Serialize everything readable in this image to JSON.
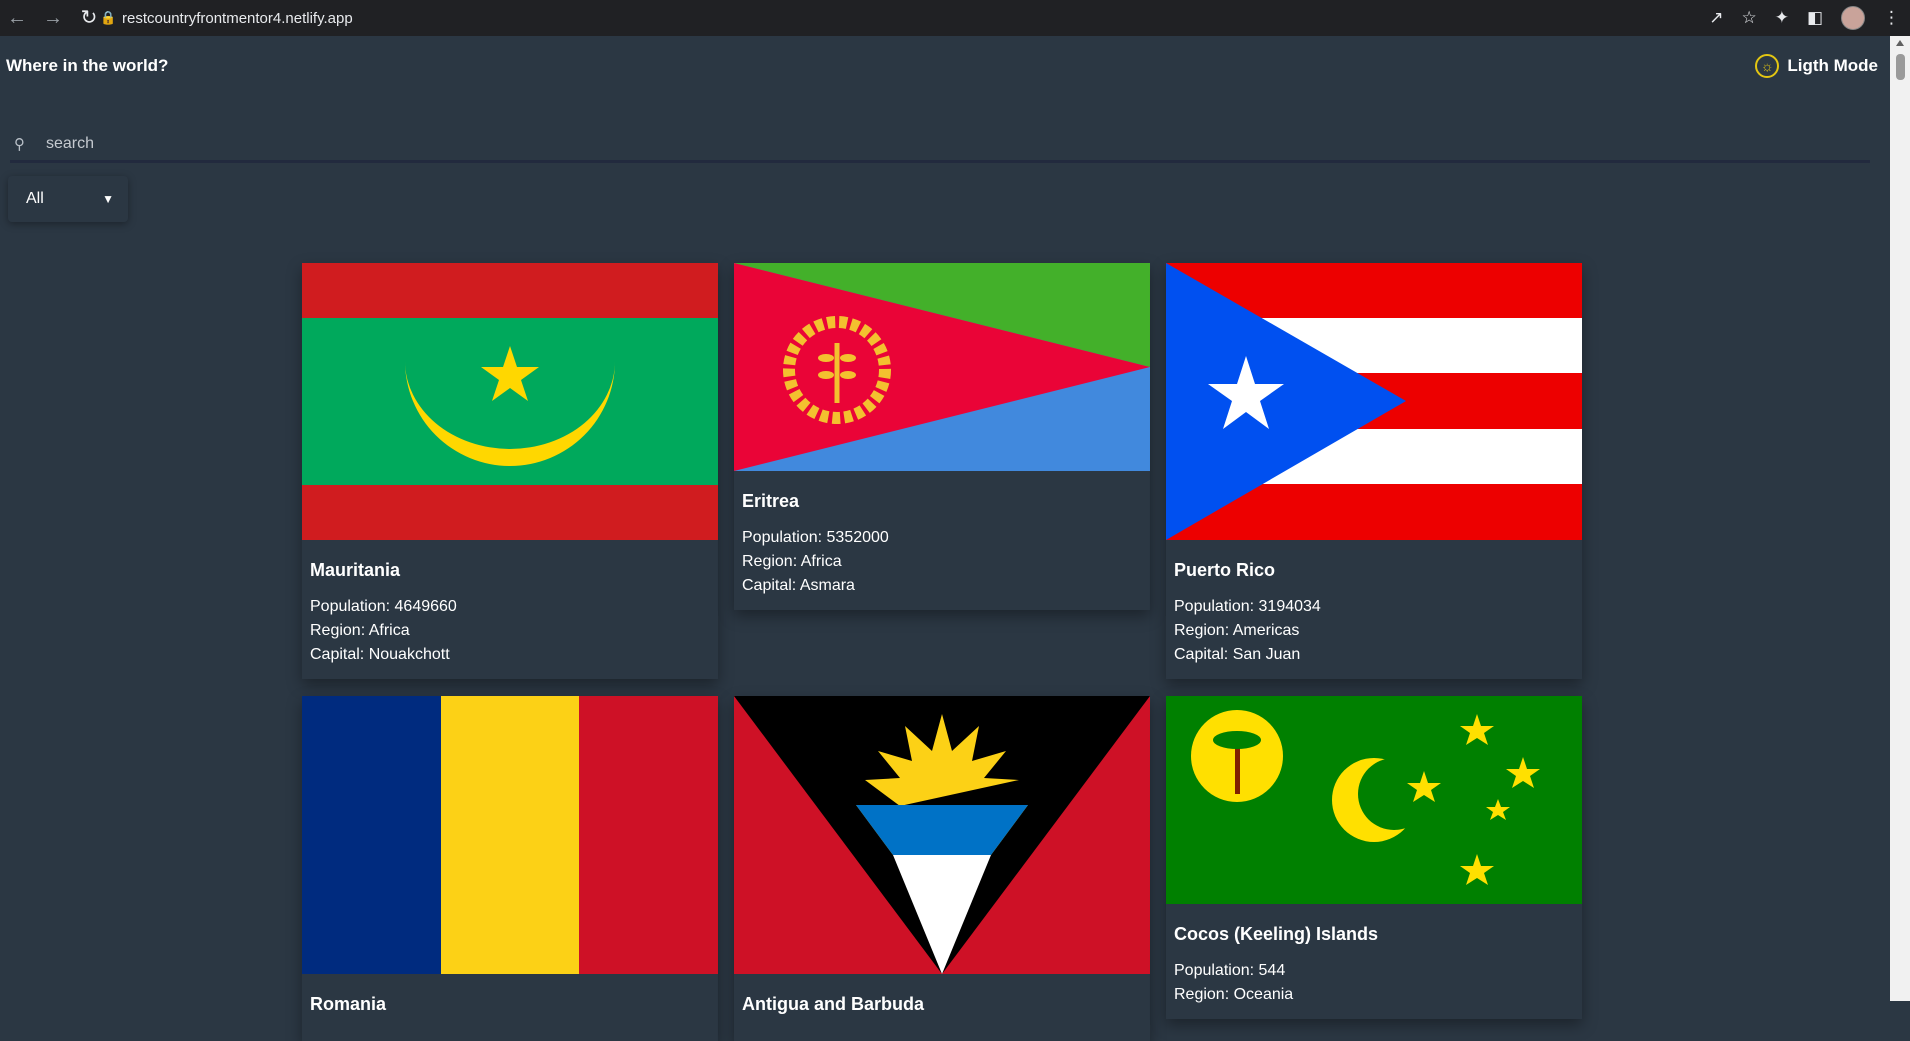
{
  "browser": {
    "url": "restcountryfrontmentor4.netlify.app",
    "icons": [
      "back-icon",
      "forward-icon",
      "reload-icon",
      "lock-icon",
      "share-icon",
      "star-icon",
      "extensions-icon",
      "sidepanel-icon",
      "avatar",
      "menu-icon"
    ]
  },
  "header": {
    "title": "Where in the world?",
    "mode_label": "Ligth Mode"
  },
  "search": {
    "placeholder": "search"
  },
  "filter": {
    "value": "All"
  },
  "labels": {
    "population": "Population:",
    "region": "Region:",
    "capital": "Capital:"
  },
  "countries": [
    {
      "name": "Mauritania",
      "population": "4649660",
      "region": "Africa",
      "capital": "Nouakchott"
    },
    {
      "name": "Eritrea",
      "population": "5352000",
      "region": "Africa",
      "capital": "Asmara"
    },
    {
      "name": "Puerto Rico",
      "population": "3194034",
      "region": "Americas",
      "capital": "San Juan"
    },
    {
      "name": "Romania"
    },
    {
      "name": "Antigua and Barbuda"
    },
    {
      "name": "Cocos (Keeling) Islands",
      "population": "544",
      "region": "Oceania"
    }
  ],
  "colors": {
    "background": "#2b3743",
    "elements": "#2b3743",
    "sun": "#e3c612"
  }
}
